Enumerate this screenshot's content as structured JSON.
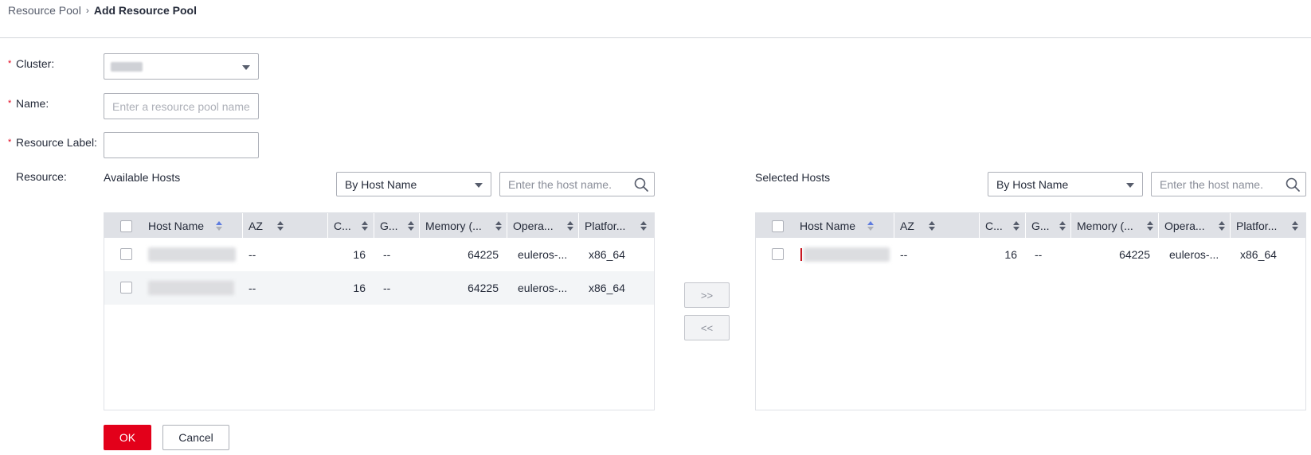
{
  "breadcrumb": {
    "parent": "Resource Pool",
    "separator": "›",
    "current": "Add Resource Pool"
  },
  "form": {
    "cluster_label": "Cluster:",
    "name_label": "Name:",
    "name_placeholder": "Enter a resource pool name.",
    "resource_label_label": "Resource Label:",
    "resource_label_value": "",
    "resource_label": "Resource:",
    "required_mark": "*"
  },
  "available": {
    "title": "Available Hosts",
    "filter_value": "By Host Name",
    "search_placeholder": "Enter the host name.",
    "columns": [
      "Host Name",
      "AZ",
      "C...",
      "G...",
      "Memory (...",
      "Opera...",
      "Platfor..."
    ],
    "rows": [
      {
        "az": "--",
        "cpu": "16",
        "gpu": "--",
        "memory": "64225",
        "os": "euleros-...",
        "platform": "x86_64"
      },
      {
        "az": "--",
        "cpu": "16",
        "gpu": "--",
        "memory": "64225",
        "os": "euleros-...",
        "platform": "x86_64"
      }
    ]
  },
  "selected": {
    "title": "Selected Hosts",
    "filter_value": "By Host Name",
    "search_placeholder": "Enter the host name.",
    "columns": [
      "Host Name",
      "AZ",
      "C...",
      "G...",
      "Memory (...",
      "Opera...",
      "Platfor..."
    ],
    "rows": [
      {
        "az": "--",
        "cpu": "16",
        "gpu": "--",
        "memory": "64225",
        "os": "euleros-...",
        "platform": "x86_64"
      }
    ]
  },
  "transfer": {
    "add": ">>",
    "remove": "<<"
  },
  "actions": {
    "ok": "OK",
    "cancel": "Cancel"
  },
  "colors": {
    "primary": "#e3001a",
    "header_bg": "#dfe1e6",
    "sort_active": "#5e7ce0",
    "row_alt": "#f3f5f7"
  }
}
